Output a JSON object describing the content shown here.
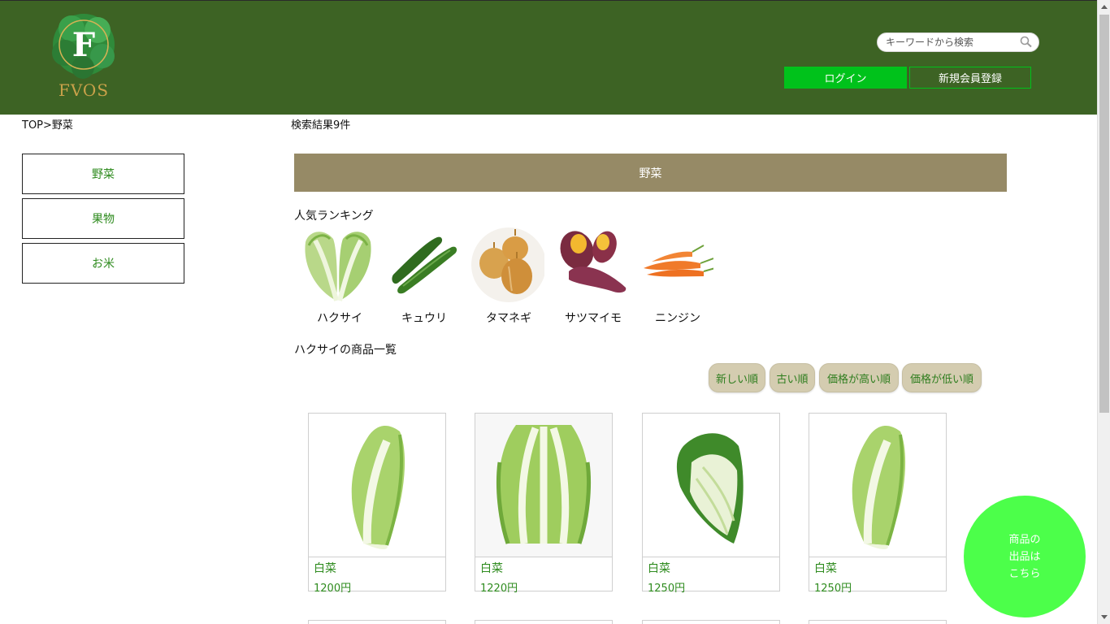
{
  "header": {
    "logo_text": "FVOS",
    "logo_letter": "F",
    "search_placeholder": "キーワードから検索",
    "login_label": "ログイン",
    "register_label": "新規会員登録"
  },
  "breadcrumb": "TOP>野菜",
  "result_count": "検索結果9件",
  "sidebar": {
    "items": [
      {
        "label": "野菜"
      },
      {
        "label": "果物"
      },
      {
        "label": "お米"
      }
    ]
  },
  "category_title": "野菜",
  "ranking": {
    "title": "人気ランキング",
    "items": [
      {
        "name": "ハクサイ",
        "icon": "napa-cabbage-image"
      },
      {
        "name": "キュウリ",
        "icon": "cucumber-image"
      },
      {
        "name": "タマネギ",
        "icon": "onion-image"
      },
      {
        "name": "サツマイモ",
        "icon": "sweet-potato-image"
      },
      {
        "name": "ニンジン",
        "icon": "carrot-image"
      }
    ]
  },
  "product_list_title": "ハクサイの商品一覧",
  "sort_buttons": [
    {
      "label": "新しい順"
    },
    {
      "label": "古い順"
    },
    {
      "label": "価格が高い順"
    },
    {
      "label": "価格が低い順"
    }
  ],
  "products": [
    {
      "name": "白菜",
      "price": "1200円"
    },
    {
      "name": "白菜",
      "price": "1220円"
    },
    {
      "name": "白菜",
      "price": "1250円"
    },
    {
      "name": "白菜",
      "price": "1250円"
    }
  ],
  "sell_button": {
    "line1": "商品の",
    "line2": "出品は",
    "line3": "こちら"
  },
  "colors": {
    "header_bg": "#3d6324",
    "accent_green": "#00c21b",
    "category_bar": "#968a66",
    "sell_button": "#4cff4a",
    "link_green": "#2e8b1e"
  }
}
